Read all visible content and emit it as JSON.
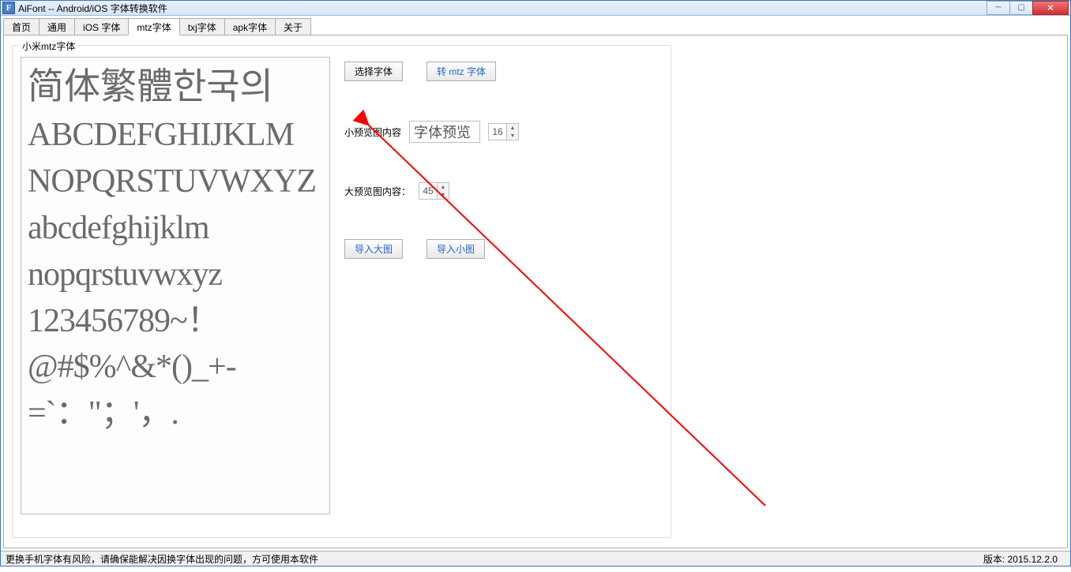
{
  "window": {
    "icon_letter": "F",
    "title": "AiFont -- Android/iOS 字体转换软件"
  },
  "tabs": [
    "首页",
    "通用",
    "iOS 字体",
    "mtz字体",
    "txj字体",
    "apk字体",
    "关于"
  ],
  "active_tab_index": 3,
  "groupbox": {
    "legend": "小米mtz字体"
  },
  "preview_lines": {
    "cjk": "简体繁體한국의",
    "upper1": "ABCDEFGHIJKLM",
    "upper2": "NOPQRSTUVWXYZ",
    "lower1": "abcdefghijklm",
    "lower2": "nopqrstuvwxyz",
    "digits": "123456789~！",
    "sym1": "@#$%^&*()_+-",
    "sym2": "=`：\"；'，."
  },
  "controls": {
    "select_font_btn": "选择字体",
    "convert_btn": "转 mtz 字体",
    "small_preview_label": "小预览图内容",
    "small_preview_value": "字体预览",
    "small_preview_size": "16",
    "large_preview_label": "大预览图内容：",
    "large_preview_size": "45",
    "import_large_btn": "导入大图",
    "import_small_btn": "导入小图"
  },
  "statusbar": {
    "left": "更换手机字体有风险，请确保能解决因换字体出现的问题，方可使用本软件",
    "right": "版本: 2015.12.2.0"
  }
}
